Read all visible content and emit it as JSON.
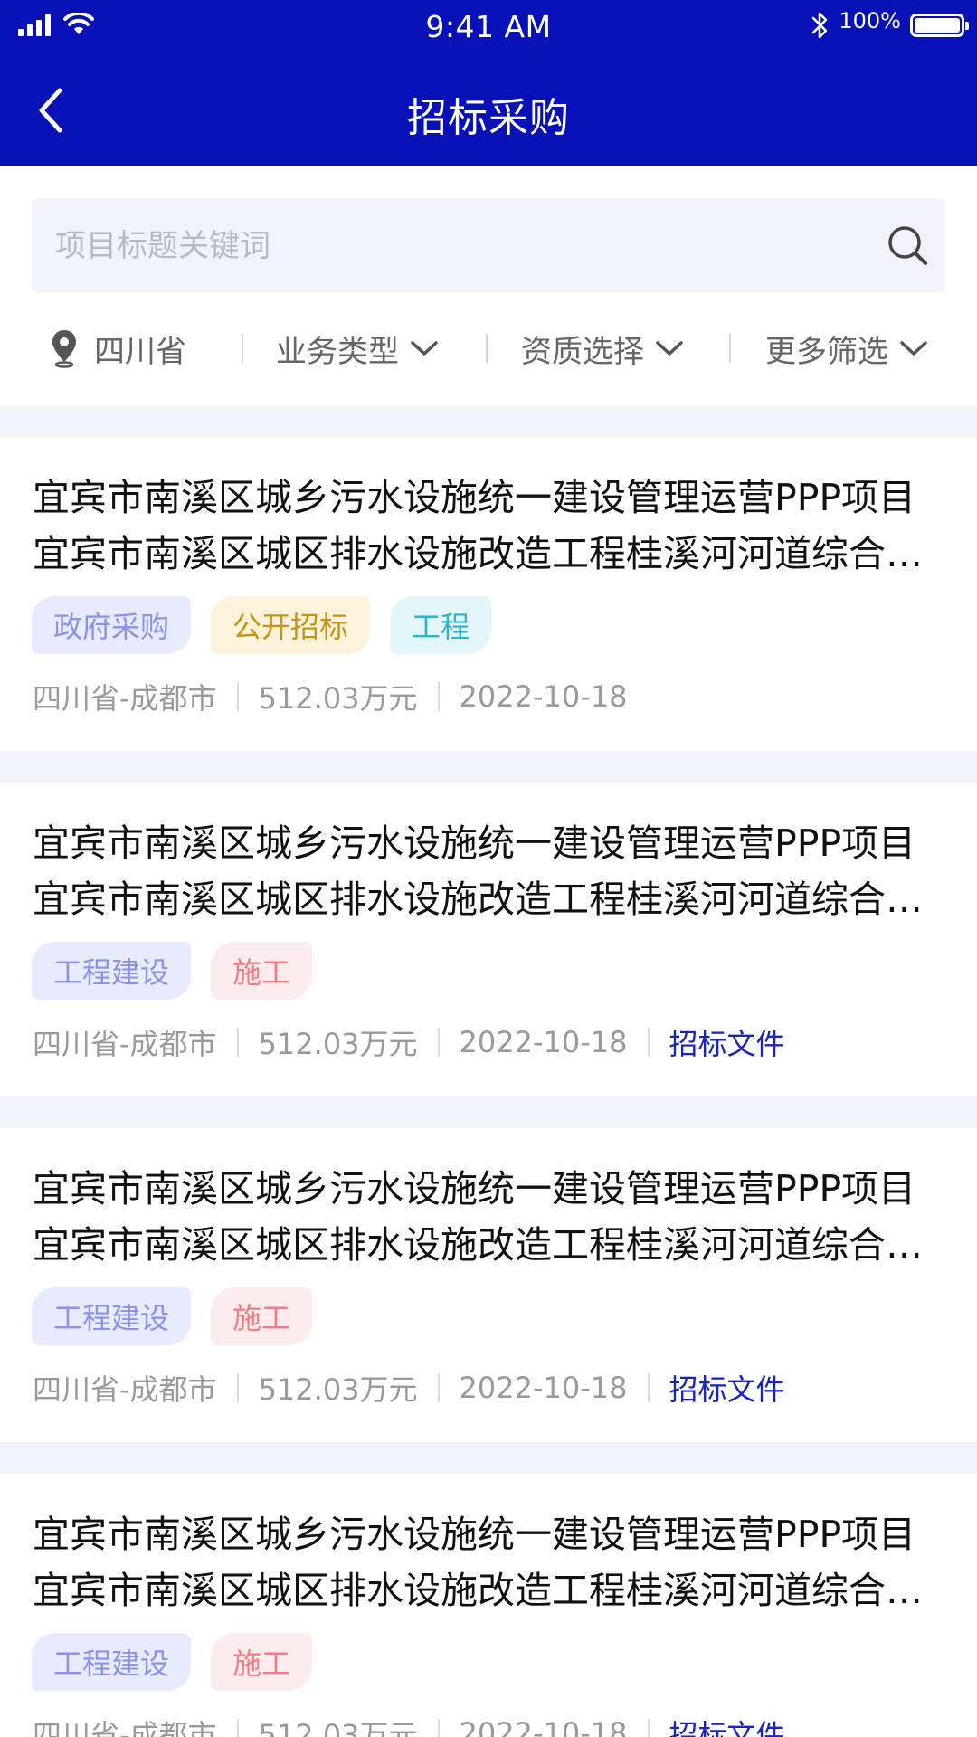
{
  "status_bar": {
    "time": "9:41 AM",
    "battery": "100%"
  },
  "header": {
    "title": "招标采购"
  },
  "search": {
    "placeholder": "项目标题关键词"
  },
  "filters": {
    "location": "四川省",
    "business_type": "业务类型",
    "qualification": "资质选择",
    "more": "更多筛选"
  },
  "colors": {
    "brand": "#0711b5",
    "link": "#1a25b8"
  },
  "items": [
    {
      "title": "宜宾市南溪区城乡污水设施统一建设管理运营PPP项目宜宾市南溪区城区排水设施改造工程桂溪河河道综合整治",
      "tags": [
        "政府采购",
        "公开招标",
        "工程"
      ],
      "location": "四川省-成都市",
      "amount": "512.03万元",
      "date": "2022-10-18",
      "doc_link": ""
    },
    {
      "title": "宜宾市南溪区城乡污水设施统一建设管理运营PPP项目宜宾市南溪区城区排水设施改造工程桂溪河河道综合整治",
      "tags": [
        "工程建设",
        "施工"
      ],
      "location": "四川省-成都市",
      "amount": "512.03万元",
      "date": "2022-10-18",
      "doc_link": "招标文件"
    },
    {
      "title": "宜宾市南溪区城乡污水设施统一建设管理运营PPP项目宜宾市南溪区城区排水设施改造工程桂溪河河道综合整治",
      "tags": [
        "工程建设",
        "施工"
      ],
      "location": "四川省-成都市",
      "amount": "512.03万元",
      "date": "2022-10-18",
      "doc_link": "招标文件"
    },
    {
      "title": "宜宾市南溪区城乡污水设施统一建设管理运营PPP项目宜宾市南溪区城区排水设施改造工程桂溪河河道综合整治",
      "tags": [
        "工程建设",
        "施工"
      ],
      "location": "四川省-成都市",
      "amount": "512.03万元",
      "date": "2022-10-18",
      "doc_link": "招标文件"
    }
  ]
}
